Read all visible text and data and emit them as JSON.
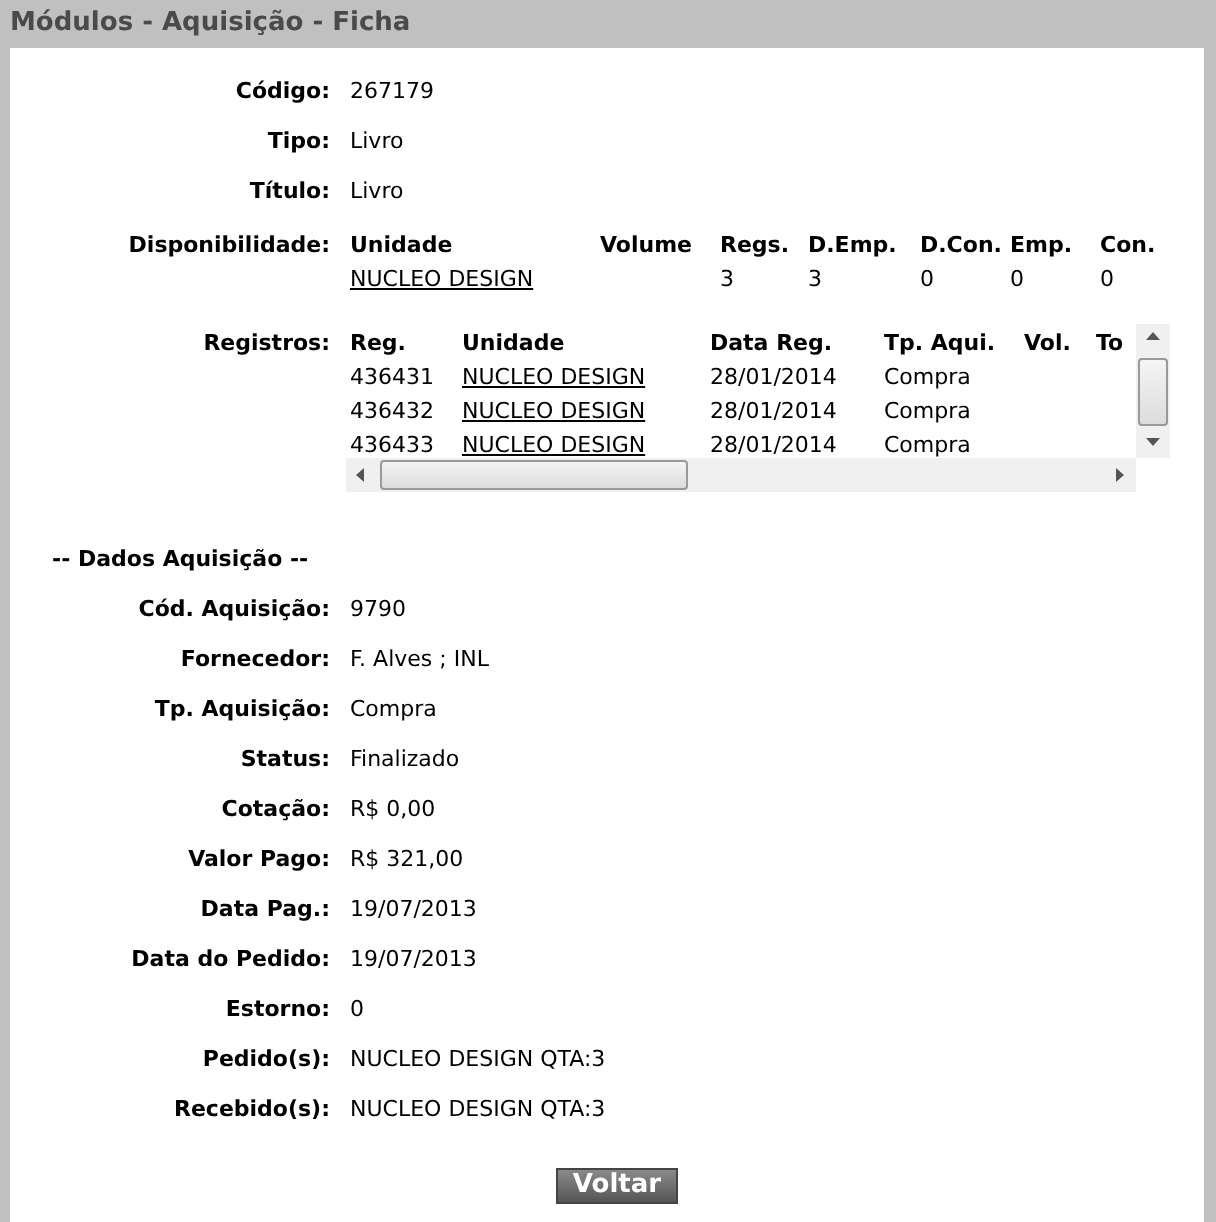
{
  "window": {
    "title": "Módulos - Aquisição - Ficha"
  },
  "fields": [
    {
      "label": "Código:",
      "value": "267179"
    },
    {
      "label": "Tipo:",
      "value": "Livro"
    },
    {
      "label": "Título:",
      "value": "Livro"
    }
  ],
  "disponibilidade": {
    "label": "Disponibilidade:",
    "columns": [
      "Unidade",
      "Volume",
      "Regs.",
      "D.Emp.",
      "D.Con.",
      "Emp.",
      "Con."
    ],
    "rows": [
      {
        "unidade": "NUCLEO DESIGN",
        "regs": "3",
        "d_emp": "3",
        "d_con": "0",
        "emp": "0",
        "con": "0"
      }
    ]
  },
  "registros": {
    "label": "Registros:",
    "columns": [
      "Reg.",
      "Unidade",
      "Data Reg.",
      "Tp. Aqui.",
      "Vol.",
      "To"
    ],
    "rows": [
      {
        "reg": "436431",
        "unidade": "NUCLEO DESIGN",
        "data_reg": "28/01/2014",
        "tp_aqui": "Compra"
      },
      {
        "reg": "436432",
        "unidade": "NUCLEO DESIGN",
        "data_reg": "28/01/2014",
        "tp_aqui": "Compra"
      },
      {
        "reg": "436433",
        "unidade": "NUCLEO DESIGN",
        "data_reg": "28/01/2014",
        "tp_aqui": "Compra"
      }
    ]
  },
  "aquisicao": {
    "heading": "-- Dados Aquisição --",
    "fields": [
      {
        "label": "Cód. Aquisição:",
        "value": "9790"
      },
      {
        "label": "Fornecedor:",
        "value": "F. Alves ; INL"
      },
      {
        "label": "Tp. Aquisição:",
        "value": "Compra"
      },
      {
        "label": "Status:",
        "value": "Finalizado"
      },
      {
        "label": "Cotação:",
        "value": "R$ 0,00"
      },
      {
        "label": "Valor Pago:",
        "value": "R$ 321,00"
      },
      {
        "label": "Data Pag.:",
        "value": "19/07/2013"
      },
      {
        "label": "Data do Pedido:",
        "value": "19/07/2013"
      },
      {
        "label": "Estorno:",
        "value": "0"
      },
      {
        "label": "Pedido(s):",
        "value": "NUCLEO DESIGN QTA:3"
      },
      {
        "label": "Recebido(s):",
        "value": "NUCLEO DESIGN QTA:3"
      }
    ]
  },
  "button": {
    "label": "Voltar"
  }
}
